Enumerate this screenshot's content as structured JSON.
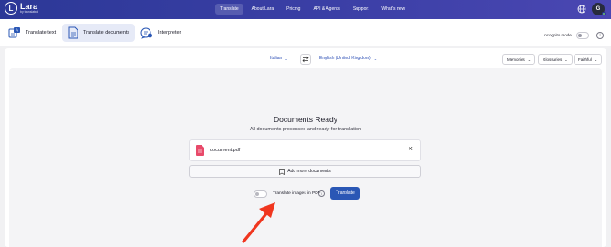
{
  "app": {
    "logo_letter": "L",
    "name": "Lara",
    "byline": "by translated"
  },
  "nav": {
    "items": [
      {
        "label": "Translate",
        "active": true
      },
      {
        "label": "About Lara",
        "active": false
      },
      {
        "label": "Pricing",
        "active": false
      },
      {
        "label": "API & Agents",
        "active": false
      },
      {
        "label": "Support",
        "active": false
      },
      {
        "label": "What's new",
        "active": false
      }
    ]
  },
  "user": {
    "avatar_initial": "G"
  },
  "modes": {
    "translate_text": "Translate text",
    "translate_documents": "Translate documents",
    "interpreter": "Interpreter"
  },
  "incognito": {
    "label": "Incognito mode",
    "enabled": false
  },
  "languages": {
    "source": "Italian",
    "target": "English (United Kingdom)"
  },
  "options": {
    "memories": "Memories",
    "glossaries": "Glossaries",
    "style": "Faithful"
  },
  "status": {
    "title": "Documents Ready",
    "subtitle": "All documents processed and ready for translation"
  },
  "document": {
    "name": "document.pdf"
  },
  "add_more_label": "Add more documents",
  "translate_images": {
    "label": "Translate images in PDF",
    "enabled": false
  },
  "translate_button": "Translate",
  "colors": {
    "nav_gradient_start": "#2c3897",
    "accent": "#2a57b5",
    "pdf_icon": "#e84a6a",
    "annotation_arrow": "#f0361f"
  },
  "icons": {
    "globe": "globe-icon",
    "swap": "swap-arrows-icon",
    "document": "pdf-file-icon",
    "close": "close-icon",
    "add": "add-document-icon",
    "info": "info-icon"
  }
}
